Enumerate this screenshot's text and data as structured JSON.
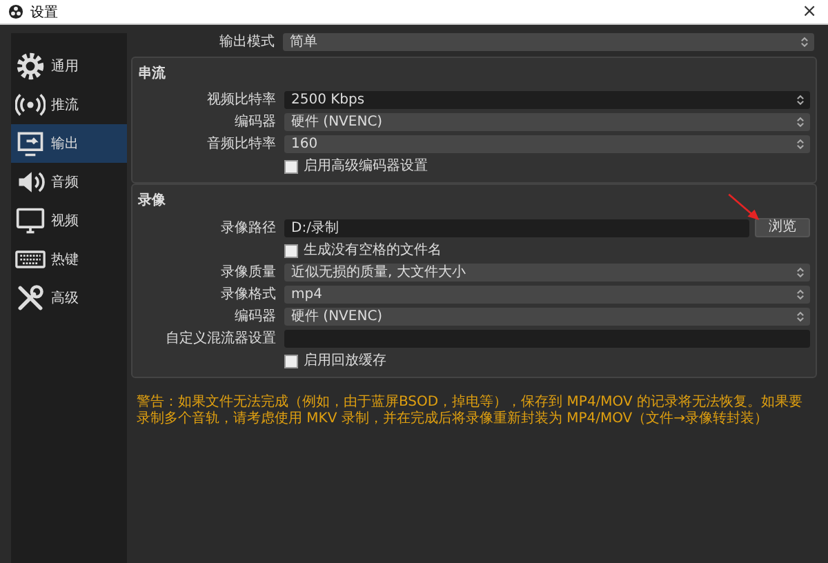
{
  "window": {
    "title": "设置",
    "close": "×"
  },
  "sidebar": {
    "items": [
      {
        "label": "通用",
        "selected": false
      },
      {
        "label": "推流",
        "selected": false
      },
      {
        "label": "输出",
        "selected": true
      },
      {
        "label": "音频",
        "selected": false
      },
      {
        "label": "视频",
        "selected": false
      },
      {
        "label": "热键",
        "selected": false
      },
      {
        "label": "高级",
        "selected": false
      }
    ]
  },
  "output_mode": {
    "label": "输出模式",
    "value": "简单"
  },
  "sections": [
    {
      "title": "串流",
      "rows": [
        {
          "kind": "spin",
          "label": "视频比特率",
          "value": "2500 Kbps"
        },
        {
          "kind": "combo",
          "label": "编码器",
          "value": "硬件 (NVENC)"
        },
        {
          "kind": "combo",
          "label": "音频比特率",
          "value": "160"
        },
        {
          "kind": "checkbox",
          "label": "启用高级编码器设置",
          "checked": false
        }
      ]
    },
    {
      "title": "录像",
      "rows": [
        {
          "kind": "path",
          "label": "录像路径",
          "value": "D:/录制",
          "button": "浏览"
        },
        {
          "kind": "checkbox",
          "label": "生成没有空格的文件名",
          "checked": false
        },
        {
          "kind": "combo",
          "label": "录像质量",
          "value": "近似无损的质量, 大文件大小"
        },
        {
          "kind": "combo",
          "label": "录像格式",
          "value": "mp4"
        },
        {
          "kind": "combo",
          "label": "编码器",
          "value": "硬件 (NVENC)"
        },
        {
          "kind": "text",
          "label": "自定义混流器设置"
        },
        {
          "kind": "checkbox",
          "label": "启用回放缓存",
          "checked": false
        }
      ]
    }
  ],
  "warning": "警告：如果文件无法完成（例如，由于蓝屏BSOD，掉电等），保存到 MP4/MOV 的记录将无法恢复。如果要录制多个音轨，请考虑使用 MKV 录制，并在完成后将录像重新封装为 MP4/MOV（文件→录像转封装）"
}
